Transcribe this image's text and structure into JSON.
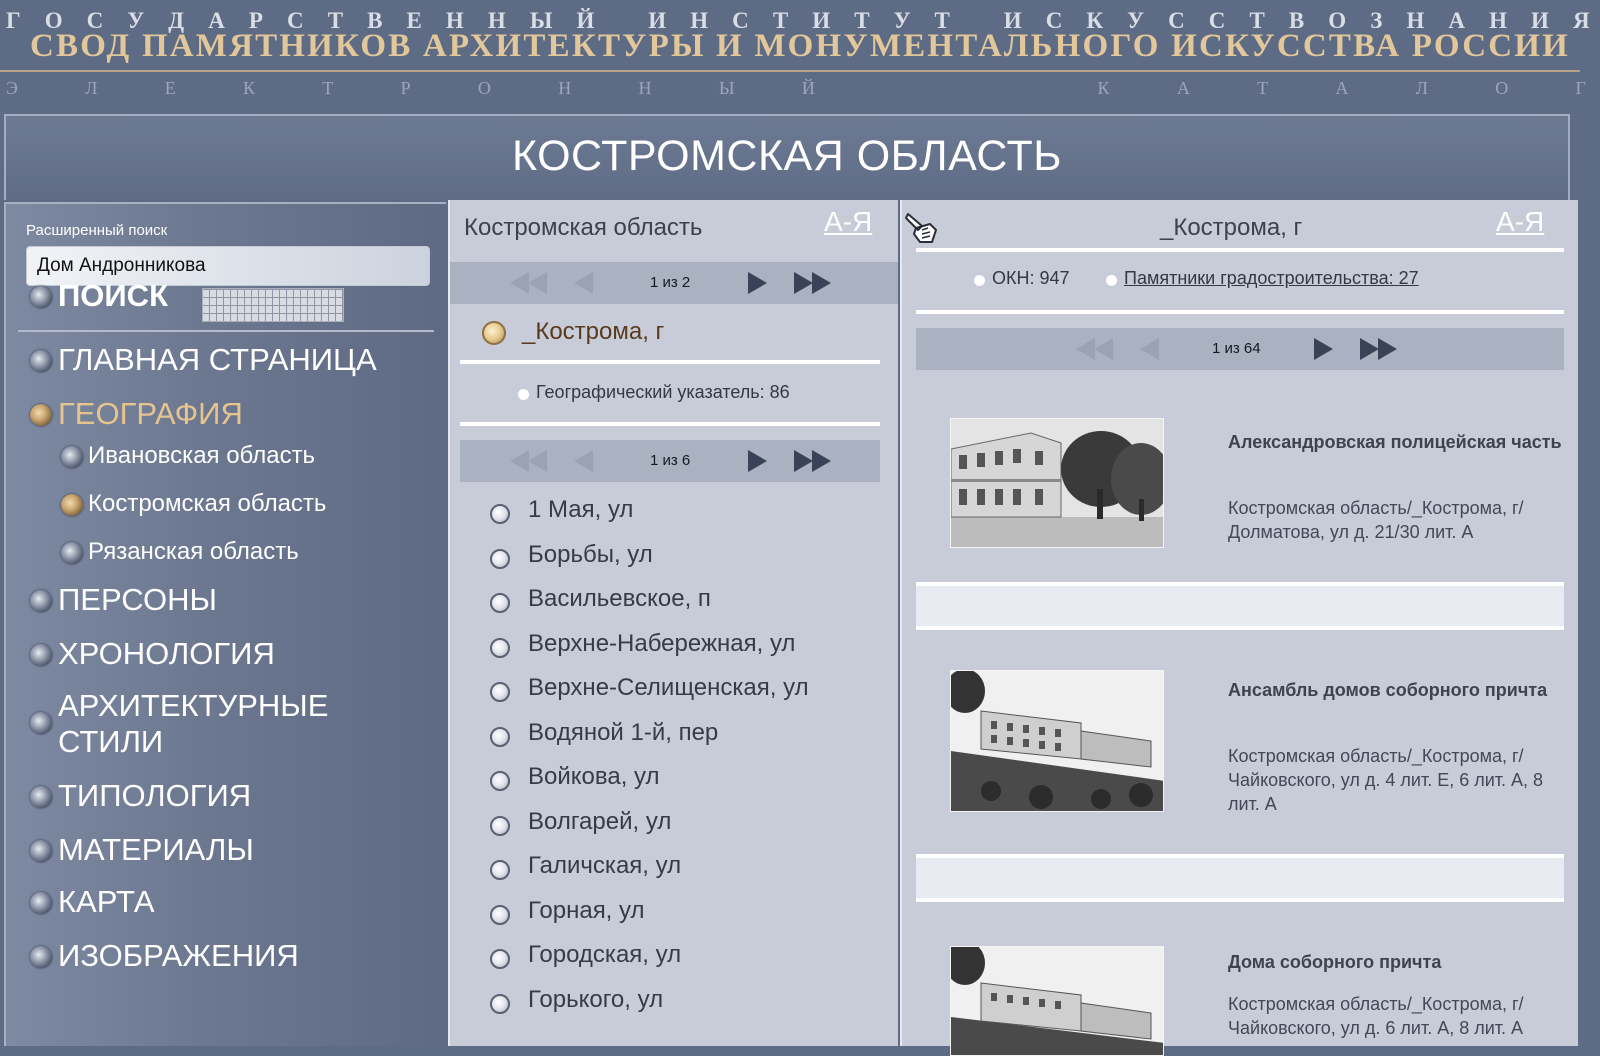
{
  "header": {
    "institute_letters": [
      "Г",
      "О",
      "С",
      "У",
      "Д",
      "А",
      "Р",
      "С",
      "Т",
      "В",
      "Е",
      "Н",
      "Н",
      "Ы",
      "Й",
      " ",
      "И",
      "Н",
      "С",
      "Т",
      "И",
      "Т",
      "У",
      "Т",
      " ",
      "И",
      "С",
      "К",
      "У",
      "С",
      "С",
      "Т",
      "В",
      "О",
      "З",
      "Н",
      "А",
      "Н",
      "И",
      "Я"
    ],
    "title": "СВОД ПАМЯТНИКОВ АРХИТЕКТУРЫ И МОНУМЕНТАЛЬНОГО ИСКУССТВА РОССИИ",
    "catalog_letters": [
      "Э",
      "Л",
      "Е",
      "К",
      "Т",
      "Р",
      "О",
      "Н",
      "Н",
      "Ы",
      "Й",
      " ",
      " ",
      " ",
      "К",
      "А",
      "Т",
      "А",
      "Л",
      "О",
      "Г"
    ],
    "region_title": "КОСТРОМСКАЯ ОБЛАСТЬ"
  },
  "sidebar": {
    "advanced_search_label": "Расширенный поиск",
    "search_value": "Дом Андронникова",
    "search_label": "ПОИСК",
    "items": [
      {
        "label": "ГЛАВНАЯ СТРАНИЦА"
      },
      {
        "label": "ГЕОГРАФИЯ"
      },
      {
        "label": "Ивановская область"
      },
      {
        "label": "Костромская область"
      },
      {
        "label": "Рязанская область"
      },
      {
        "label": "ПЕРСОНЫ"
      },
      {
        "label": "ХРОНОЛОГИЯ"
      },
      {
        "label": "АРХИТЕКТУРНЫЕ"
      },
      {
        "label": "СТИЛИ"
      },
      {
        "label": "ТИПОЛОГИЯ"
      },
      {
        "label": "МАТЕРИАЛЫ"
      },
      {
        "label": "КАРТА"
      },
      {
        "label": "ИЗОБРАЖЕНИЯ"
      }
    ]
  },
  "middle": {
    "title": "Костромская область",
    "az": "А-Я",
    "pager1": "1 из 2",
    "selected_city": "_Кострома, г",
    "geo_index": "Географический указатель: 86",
    "pager2": "1 из 6",
    "streets": [
      "1 Мая, ул",
      "Борьбы, ул",
      "Васильевское, п",
      "Верхне-Набережная, ул",
      "Верхне-Селищенская, ул",
      "Водяной 1-й, пер",
      "Войкова, ул",
      "Волгарей, ул",
      "Галичская, ул",
      "Горная, ул",
      "Городская, ул",
      "Горького, ул"
    ]
  },
  "right": {
    "title": "_Кострома, г",
    "az": "А-Я",
    "okn": "ОКН: 947",
    "urban": "Памятники градостроительства: 27",
    "pager": "1 из 64",
    "monuments": [
      {
        "title": "Александровская полицейская часть",
        "address": "Костромская область/_Кострома, г/ Долматова, ул д. 21/30 лит. А"
      },
      {
        "title": "Ансамбль домов соборного причта",
        "address": "Костромская область/_Кострома, г/ Чайковского, ул д. 4 лит. Е, 6 лит. А, 8 лит. А"
      },
      {
        "title": "Дома соборного причта",
        "address": "Костромская область/_Кострома, г/ Чайковского, ул д. 6 лит. А, 8 лит. А"
      }
    ]
  },
  "colors": {
    "accent_gold": "#e7c38e",
    "panel_bg": "#c7ccd8",
    "page_bg": "#5e6b85"
  }
}
